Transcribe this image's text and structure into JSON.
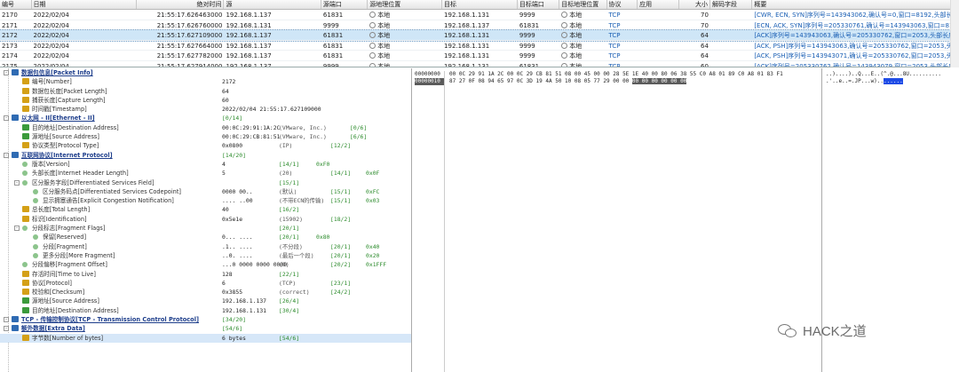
{
  "packet_list": {
    "headers": [
      "编号",
      "日期",
      "绝对时间",
      "源",
      "源端口",
      "源地理位置",
      "目标",
      "目标端口",
      "目标地理位置",
      "协议",
      "应用",
      "大小",
      "解码字段",
      "概要"
    ],
    "rows": [
      {
        "no": "2170",
        "date": "2022/02/04",
        "time": "21:55:17.626463000",
        "src": "192.168.1.137",
        "sport": "61831",
        "sgeo": "本地",
        "dst": "192.168.1.131",
        "dport": "9999",
        "dgeo": "本地",
        "proto": "TCP",
        "app": "",
        "size": "70",
        "dec": "",
        "summary": "[CWR, ECN, SYN]序列号=143943062,确认号=0,窗口=8192,头部长度=3..."
      },
      {
        "no": "2171",
        "date": "2022/02/04",
        "time": "21:55:17.626760000",
        "src": "192.168.1.131",
        "sport": "9999",
        "sgeo": "本地",
        "dst": "192.168.1.137",
        "dport": "61831",
        "dgeo": "本地",
        "proto": "TCP",
        "app": "",
        "size": "70",
        "dec": "",
        "summary": "[ECN, ACK, SYN]序列号=205330761,确认号=143943063,窗口=8192,头..."
      },
      {
        "no": "2172",
        "date": "2022/02/04",
        "time": "21:55:17.627109000",
        "src": "192.168.1.137",
        "sport": "61831",
        "sgeo": "本地",
        "dst": "192.168.1.131",
        "dport": "9999",
        "dgeo": "本地",
        "proto": "TCP",
        "app": "",
        "size": "64",
        "dec": "",
        "summary": "[ACK]序列号=143943063,确认号=205330762,窗口=2053,头部长度=20..."
      },
      {
        "no": "2173",
        "date": "2022/02/04",
        "time": "21:55:17.627664000",
        "src": "192.168.1.137",
        "sport": "61831",
        "sgeo": "本地",
        "dst": "192.168.1.131",
        "dport": "9999",
        "dgeo": "本地",
        "proto": "TCP",
        "app": "",
        "size": "64",
        "dec": "",
        "summary": "[ACK, PSH]序列号=143943063,确认号=205330762,窗口=2053,头部长..."
      },
      {
        "no": "2174",
        "date": "2022/02/04",
        "time": "21:55:17.627782000",
        "src": "192.168.1.137",
        "sport": "61831",
        "sgeo": "本地",
        "dst": "192.168.1.131",
        "dport": "9999",
        "dgeo": "本地",
        "proto": "TCP",
        "app": "",
        "size": "64",
        "dec": "",
        "summary": "[ACK, PSH]序列号=143943071,确认号=205330762,窗口=2053,头部长..."
      },
      {
        "no": "2175",
        "date": "2022/02/04",
        "time": "21:55:17.627914000",
        "src": "192.168.1.137",
        "sport": "9999",
        "sgeo": "本地",
        "dst": "192.168.1.131",
        "dport": "61831",
        "dgeo": "本地",
        "proto": "TCP",
        "app": "",
        "size": "60",
        "dec": "",
        "summary": "[ACK]序列号=205330762,确认号=143943079,窗口=2053,头部长度=..."
      }
    ]
  },
  "tree": [
    {
      "depth": 0,
      "icon": "hdr",
      "label": "数据包信息[Packet Info]",
      "head": true,
      "val": "",
      "note": "",
      "rng": "",
      "hex": ""
    },
    {
      "depth": 1,
      "icon": "fld",
      "label": "编号[Number]",
      "val": "2172",
      "note": "",
      "rng": "",
      "hex": ""
    },
    {
      "depth": 1,
      "icon": "fld",
      "label": "数据包长度[Packet Length]",
      "val": "64",
      "note": "",
      "rng": "",
      "hex": ""
    },
    {
      "depth": 1,
      "icon": "fld",
      "label": "捕获长度[Capture Length]",
      "val": "60",
      "note": "",
      "rng": "",
      "hex": ""
    },
    {
      "depth": 1,
      "icon": "fld",
      "label": "时间戳[Timestamp]",
      "val": "2022/02/04 21:55:17.627109000",
      "note": "",
      "rng": "",
      "hex": ""
    },
    {
      "depth": 0,
      "icon": "hdr",
      "label": "以太网 - II[Ethernet - II]",
      "head": true,
      "val": "",
      "note": "",
      "rng": "[0/14]",
      "hex": ""
    },
    {
      "depth": 1,
      "icon": "addr",
      "label": "目的地址[Destination Address]",
      "val": "00:0C:29:91:1A:2C",
      "note": "(VMware, Inc.)",
      "rng": "[0/6]",
      "hex": ""
    },
    {
      "depth": 1,
      "icon": "addr",
      "label": "源地址[Source Address]",
      "val": "00:0C:29:CB:81:51",
      "note": "(VMware, Inc.)",
      "rng": "[6/6]",
      "hex": ""
    },
    {
      "depth": 1,
      "icon": "fld",
      "label": "协议类型[Protocol Type]",
      "val": "0x0800",
      "note": "(IP)",
      "rng": "[12/2]",
      "hex": ""
    },
    {
      "depth": 0,
      "icon": "hdr",
      "label": "互联网协议[Internet Protocol]",
      "head": true,
      "val": "",
      "note": "",
      "rng": "[14/20]",
      "hex": ""
    },
    {
      "depth": 1,
      "icon": "bit",
      "label": "版本[Version]",
      "val": "4",
      "note": "",
      "rng": "[14/1]",
      "hex": "0xF0"
    },
    {
      "depth": 1,
      "icon": "bit",
      "label": "头部长度[Internet Header Length]",
      "val": "5",
      "note": "(20)",
      "rng": "[14/1]",
      "hex": "0x0F"
    },
    {
      "depth": 1,
      "icon": "bit",
      "label": "区分服务字段[Differentiated Services Field]",
      "val": "",
      "note": "",
      "rng": "[15/1]",
      "hex": ""
    },
    {
      "depth": 2,
      "icon": "bit",
      "label": "区分服务码点[Differentiated Services Codepoint]",
      "val": "0000 00..",
      "note": "(默认)",
      "rng": "[15/1]",
      "hex": "0xFC"
    },
    {
      "depth": 2,
      "icon": "bit",
      "label": "显示拥塞通告[Explicit Congestion Notification]",
      "val": ".... ..00",
      "note": "(不带ECN的传输)",
      "rng": "[15/1]",
      "hex": "0x03"
    },
    {
      "depth": 1,
      "icon": "fld",
      "label": "总长度[Total Length]",
      "val": "40",
      "note": "",
      "rng": "[16/2]",
      "hex": ""
    },
    {
      "depth": 1,
      "icon": "fld",
      "label": "标识[Identification]",
      "val": "0x5e1e",
      "note": "(15902)",
      "rng": "[18/2]",
      "hex": ""
    },
    {
      "depth": 1,
      "icon": "bit",
      "label": "分段标志[Fragment Flags]",
      "val": "",
      "note": "",
      "rng": "[20/1]",
      "hex": ""
    },
    {
      "depth": 2,
      "icon": "bit",
      "label": "保留[Reserved]",
      "val": "0... ....",
      "note": "",
      "rng": "[20/1]",
      "hex": "0x80"
    },
    {
      "depth": 2,
      "icon": "bit",
      "label": "分段[Fragment]",
      "val": ".1.. ....",
      "note": "(不分段)",
      "rng": "[20/1]",
      "hex": "0x40"
    },
    {
      "depth": 2,
      "icon": "bit",
      "label": "更多分段[More Fragment]",
      "val": "..0. ....",
      "note": "(最后一个段)",
      "rng": "[20/1]",
      "hex": "0x20"
    },
    {
      "depth": 1,
      "icon": "bit",
      "label": "分段偏移[Fragment Offset]",
      "val": "...0 0000 0000 0000",
      "note": "(0)",
      "rng": "[20/2]",
      "hex": "0x1FFF"
    },
    {
      "depth": 1,
      "icon": "fld",
      "label": "存活时间[Time to Live]",
      "val": "128",
      "note": "",
      "rng": "[22/1]",
      "hex": ""
    },
    {
      "depth": 1,
      "icon": "fld",
      "label": "协议[Protocol]",
      "val": "6",
      "note": "(TCP)",
      "rng": "[23/1]",
      "hex": ""
    },
    {
      "depth": 1,
      "icon": "fld",
      "label": "校验和[Checksum]",
      "val": "0x3855",
      "note": "(correct)",
      "rng": "[24/2]",
      "hex": ""
    },
    {
      "depth": 1,
      "icon": "addr",
      "label": "源地址[Source Address]",
      "val": "192.168.1.137",
      "note": "",
      "rng": "[26/4]",
      "hex": ""
    },
    {
      "depth": 1,
      "icon": "addr",
      "label": "目的地址[Destination Address]",
      "val": "192.168.1.131",
      "note": "",
      "rng": "[30/4]",
      "hex": ""
    },
    {
      "depth": 0,
      "icon": "hdr",
      "label": "TCP - 传输控制协议[TCP - Transmission Control Protocol]",
      "head": true,
      "val": "",
      "note": "",
      "rng": "[34/20]",
      "hex": ""
    },
    {
      "depth": 0,
      "icon": "hdr",
      "label": "额外数据[Extra Data]",
      "head": true,
      "val": "",
      "note": "",
      "rng": "[54/6]",
      "hex": ""
    },
    {
      "depth": 1,
      "icon": "fld",
      "label": "字节数[Number of bytes]",
      "val": "6 bytes",
      "note": "",
      "rng": "[54/6]",
      "hex": "",
      "sel": true
    }
  ],
  "hex": {
    "offsets": [
      "00000000",
      "00000010"
    ],
    "line1": "00 0C 29 91 1A 2C 00 0C 29 CB 81 51 08 00 45 00 00 28 5E 1E 40 00 80 06 38 55 C0 A8 01 89 C0 A8 01 83 F1",
    "line2_plain": "87 27 0F 08 94 65 97 0C 3D 19 4A 50 10 08 05 77 29 00 00 ",
    "line2_sel": "00 00 00 00 00 00",
    "ascii1": "..)....)..Q...E..(^.@...8U..........",
    "ascii2_plain": ".'..e..=.JP...w)..",
    "ascii2_sel": "......"
  },
  "watermark": "HACK之道"
}
